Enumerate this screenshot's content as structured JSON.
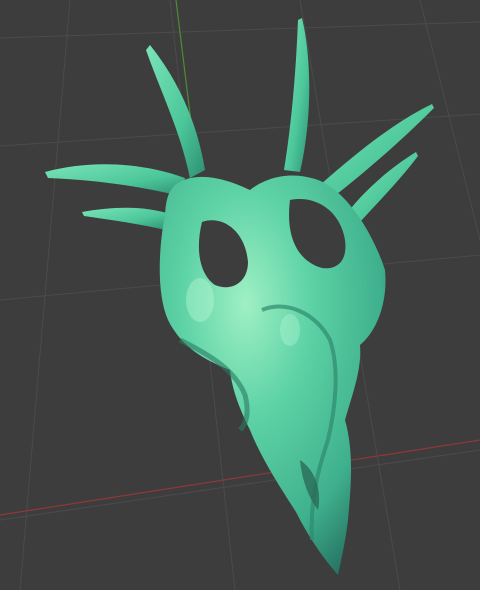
{
  "viewport": {
    "background_color": "#3d3d3d",
    "grid_line_color": "#4a4a4a",
    "y_axis_color": "#5a9a3a",
    "x_axis_color": "#9a3a3a",
    "object_name": "skull-mesh-icon",
    "object_base_color": "#4cc79a",
    "object_highlight_color": "#8fe8b8",
    "object_shadow_color": "#2a7a63"
  }
}
